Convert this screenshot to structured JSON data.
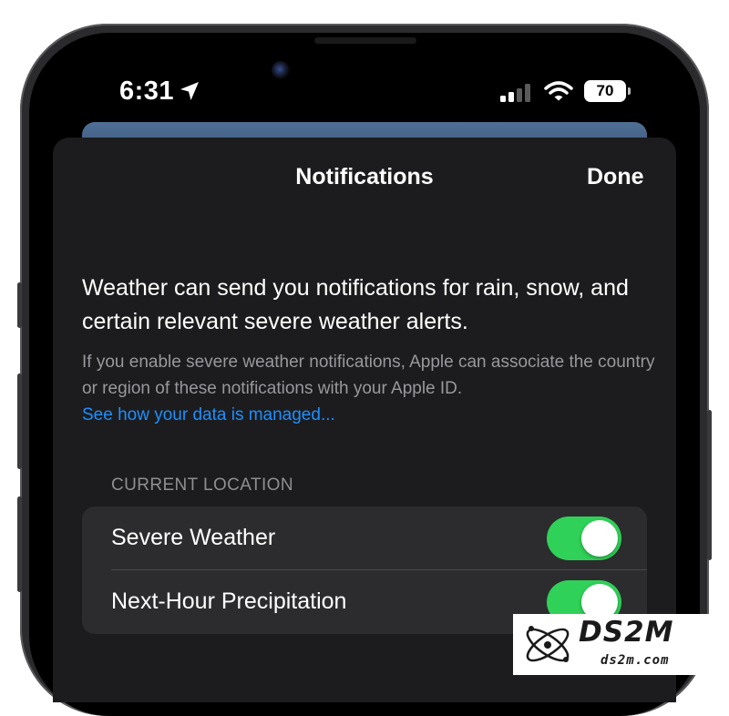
{
  "status_bar": {
    "time": "6:31",
    "battery_level": "70",
    "icons": [
      "location-arrow-icon",
      "signal-icon",
      "wifi-icon",
      "battery-icon"
    ]
  },
  "sheet": {
    "title": "Notifications",
    "done_label": "Done",
    "intro": "Weather can send you notifications for rain, snow, and certain relevant severe weather alerts.",
    "detail": "If you enable severe weather notifications, Apple can associate the country or region of these notifications with your Apple ID.",
    "link": "See how your data is managed..."
  },
  "current_location": {
    "header": "CURRENT LOCATION",
    "rows": [
      {
        "label": "Severe Weather",
        "enabled": true
      },
      {
        "label": "Next-Hour Precipitation",
        "enabled": true
      }
    ]
  },
  "colors": {
    "accent_link": "#1e8fff",
    "toggle_on": "#30d158",
    "sheet_bg": "#1c1c1e",
    "group_bg": "#2c2c2e"
  },
  "watermark": {
    "brand": "DS2M",
    "domain": "ds2m.com"
  }
}
